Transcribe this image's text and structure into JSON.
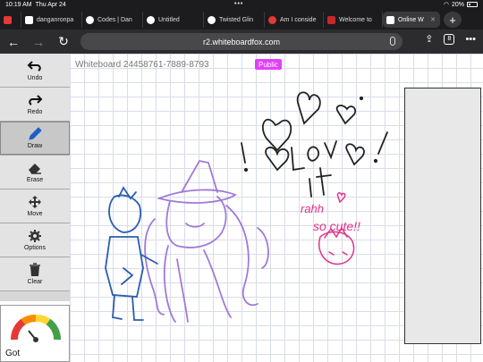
{
  "status": {
    "time": "10:19 AM",
    "date": "Thu Apr 24",
    "dots": "•••",
    "battery": "20%"
  },
  "tabs": [
    {
      "title": "",
      "color": "#e53935"
    },
    {
      "title": "danganronpa",
      "color": "#ffffff"
    },
    {
      "title": "Codes | Dan",
      "color": "#ffffff"
    },
    {
      "title": "Untitled",
      "color": "#ffffff"
    },
    {
      "title": "Twisted Glin",
      "color": "#ffffff"
    },
    {
      "title": "Am I conside",
      "color": "#e53935"
    },
    {
      "title": "Welcome to",
      "color": "#c62828"
    },
    {
      "title": "Online W",
      "color": "#ffffff"
    }
  ],
  "toolbar": {
    "back": "←",
    "forward": "→",
    "reload": "↻",
    "url": "r2.whiteboardfox.com",
    "tabs_count": "8",
    "more": "•••"
  },
  "whiteboard": {
    "title": "Whiteboard 24458761-7889-8793",
    "badge": "Public"
  },
  "tools": [
    {
      "label": "Undo",
      "icon": "undo-icon"
    },
    {
      "label": "Redo",
      "icon": "redo-icon"
    },
    {
      "label": "Draw",
      "icon": "pencil-icon"
    },
    {
      "label": "Erase",
      "icon": "eraser-icon"
    },
    {
      "label": "Move",
      "icon": "move-icon"
    },
    {
      "label": "Options",
      "icon": "gear-icon"
    },
    {
      "label": "Clear",
      "icon": "trash-icon"
    }
  ],
  "feedback": {
    "label": "Got"
  },
  "sketch": {
    "text1": "Love it",
    "text2": "rahh",
    "text3": "so cute!!"
  },
  "colors": {
    "blue": "#2a5db0",
    "purple": "#a07ad8",
    "pink": "#e0338a",
    "black": "#222222"
  }
}
